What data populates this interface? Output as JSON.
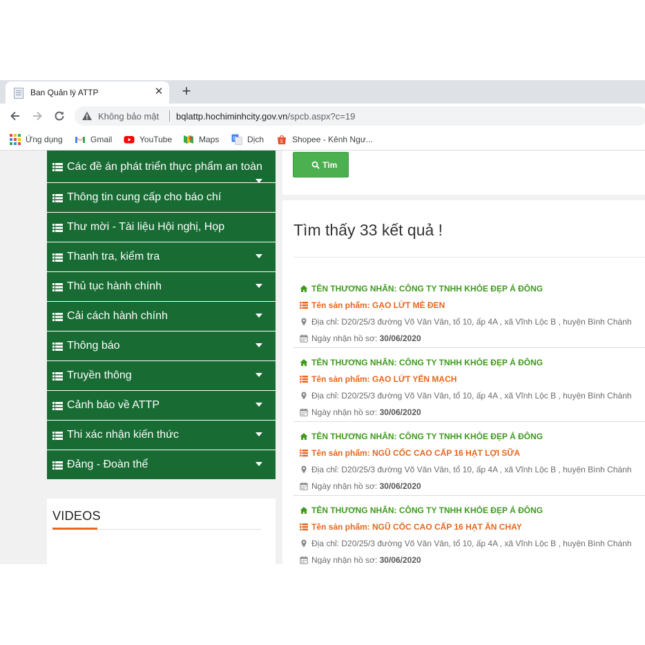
{
  "browser": {
    "tab_title": "Ban Quản lý ATTP",
    "tab_close": "✕",
    "new_tab": "+",
    "security_label": "Không bảo mật",
    "url_host": "bqlattp.hochiminhcity.gov.vn",
    "url_path": "/spcb.aspx?c=19",
    "bookmarks": [
      {
        "label": "Ứng dụng",
        "icon": "apps-grid-icon"
      },
      {
        "label": "Gmail",
        "icon": "gmail-icon"
      },
      {
        "label": "YouTube",
        "icon": "youtube-icon"
      },
      {
        "label": "Maps",
        "icon": "maps-icon"
      },
      {
        "label": "Dịch",
        "icon": "translate-icon"
      },
      {
        "label": "Shopee - Kênh Ngư...",
        "icon": "shopee-icon"
      }
    ]
  },
  "sidebar": {
    "items": [
      {
        "label": "Các đề án phát triển thực phẩm an toàn",
        "has_caret": true
      },
      {
        "label": "Thông tin cung cấp cho báo chí",
        "has_caret": false
      },
      {
        "label": "Thư mời - Tài liệu Hội nghị, Họp",
        "has_caret": false
      },
      {
        "label": "Thanh tra, kiểm tra",
        "has_caret": true
      },
      {
        "label": "Thủ tục hành chính",
        "has_caret": true
      },
      {
        "label": "Cải cách hành chính",
        "has_caret": true
      },
      {
        "label": "Thông báo",
        "has_caret": true
      },
      {
        "label": "Truyền thông",
        "has_caret": true
      },
      {
        "label": "Cảnh báo về ATTP",
        "has_caret": true
      },
      {
        "label": "Thi xác nhận kiến thức",
        "has_caret": true
      },
      {
        "label": "Đảng - Đoàn thể",
        "has_caret": true
      }
    ],
    "videos_title": "VIDEOS"
  },
  "search": {
    "button_label": "Tìm"
  },
  "results": {
    "heading": "Tìm thấy 33 kết quả !",
    "items": [
      {
        "merchant": "TÊN THƯƠNG NHÂN: CÔNG TY TNHH KHỎE ĐẸP Á ĐÔNG",
        "product": "Tên sản phẩm: GẠO LỨT MÈ ĐEN",
        "address": "Địa chỉ: D20/25/3 đường Võ Văn Vân, tổ 10, ấp 4A , xã Vĩnh Lộc B , huyện Bình Chánh",
        "date_label": "Ngày nhận hồ sơ:",
        "date": "30/06/2020"
      },
      {
        "merchant": "TÊN THƯƠNG NHÂN: CÔNG TY TNHH KHỎE ĐẸP Á ĐÔNG",
        "product": "Tên sản phẩm: GẠO LỨT YẾN MẠCH",
        "address": "Địa chỉ: D20/25/3 đường Võ Văn Vân, tổ 10, ấp 4A , xã Vĩnh Lộc B , huyện Bình Chánh",
        "date_label": "Ngày nhận hồ sơ:",
        "date": "30/06/2020"
      },
      {
        "merchant": "TÊN THƯƠNG NHÂN: CÔNG TY TNHH KHỎE ĐẸP Á ĐÔNG",
        "product": "Tên sản phẩm: NGŨ CỐC CAO CẤP 16 HẠT LỢI SỮA",
        "address": "Địa chỉ: D20/25/3 đường Võ Văn Vân, tổ 10, ấp 4A , xã Vĩnh Lộc B , huyện Bình Chánh",
        "date_label": "Ngày nhận hồ sơ:",
        "date": "30/06/2020"
      },
      {
        "merchant": "TÊN THƯƠNG NHÂN: CÔNG TY TNHH KHỎE ĐẸP Á ĐÔNG",
        "product": "Tên sản phẩm: NGŨ CỐC CAO CẤP 16 HẠT ĂN CHAY",
        "address": "Địa chỉ: D20/25/3 đường Võ Văn Vân, tổ 10, ấp 4A , xã Vĩnh Lộc B , huyện Bình Chánh",
        "date_label": "Ngày nhận hồ sơ:",
        "date": "30/06/2020"
      }
    ]
  },
  "colors": {
    "menu_green": "#186b33",
    "button_green": "#4caf50",
    "merchant_green": "#3f9a1f",
    "product_orange": "#e8661c",
    "accent_orange": "#e8661c"
  }
}
